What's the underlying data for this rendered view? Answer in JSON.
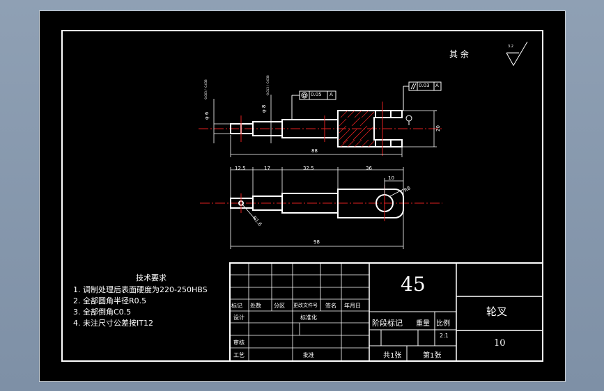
{
  "surface_finish": {
    "label": "其 余",
    "symbol_value": "3.2"
  },
  "dims": {
    "d1": "φ 6",
    "d1_tol": "-0.003 / -0.038",
    "d2": "φ 8",
    "d2_tol": "-0.013 / -0.038",
    "concentricity_value": "0.05",
    "concentricity_datum": "A",
    "parallel_value": "0.03",
    "parallel_datum": "A",
    "slot_height": "20",
    "overall_length_top": "88",
    "seg1": "12.5",
    "seg2": "17",
    "seg3": "32.5",
    "seg4": "36",
    "end_width": "10",
    "radius_big": "R8",
    "radius_small": "R1.6",
    "overall_length_bottom": "98"
  },
  "tech_requirements": {
    "title": "技术要求",
    "items": [
      "1. 调制处理后表面硬度为220-250HBS",
      "2. 全部圆角半径R0.5",
      "3. 全部倒角C0.5",
      "4. 未注尺寸公差按IT12"
    ]
  },
  "title_block": {
    "material": "45",
    "part_name": "轮叉",
    "drawing_no": "10",
    "col_labels": [
      "标记",
      "处数",
      "分区",
      "更改文件号",
      "签名",
      "年月日"
    ],
    "design": "设计",
    "standardize": "标准化",
    "review": "审核",
    "process": "工艺",
    "approve": "批准",
    "stage_mark": "阶段标记",
    "weight": "重量",
    "scale_label": "比例",
    "scale_value": "2:1",
    "total_sheets": "共1张",
    "sheet_no": "第1张"
  }
}
